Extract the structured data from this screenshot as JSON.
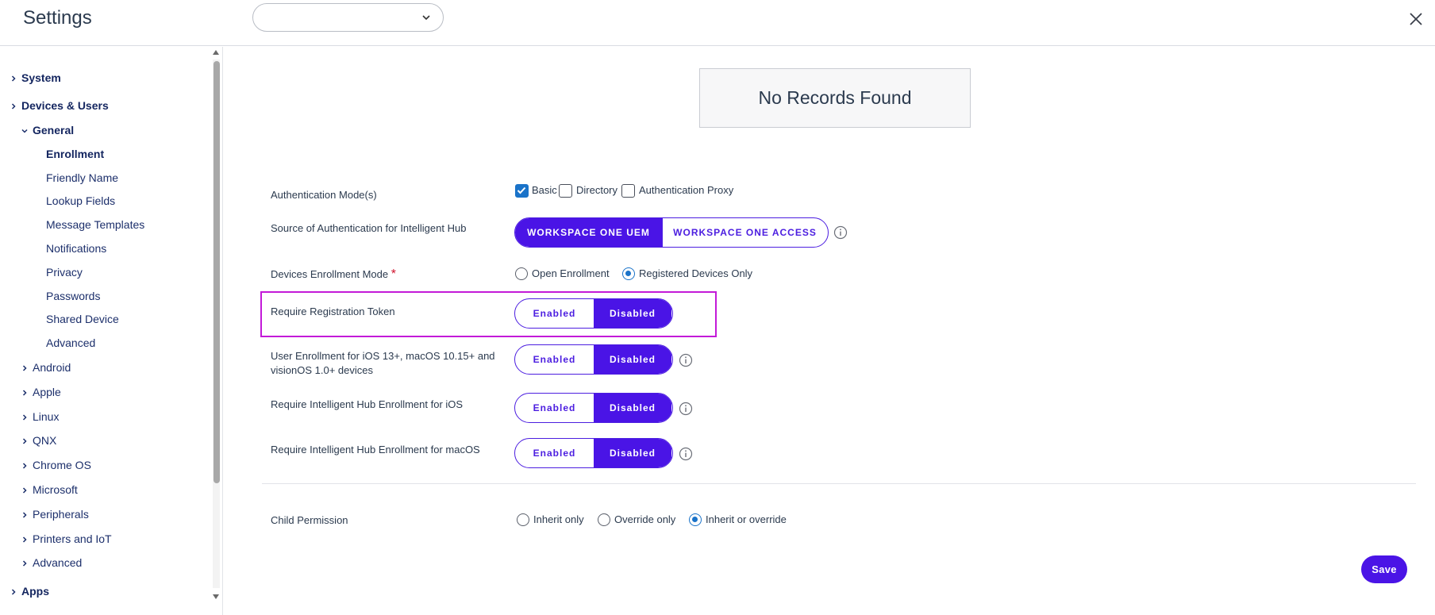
{
  "header": {
    "title": "Settings",
    "select_value": ""
  },
  "sidebar": {
    "items": [
      {
        "label": "System",
        "level": "top",
        "expanded": false
      },
      {
        "label": "Devices & Users",
        "level": "top",
        "expanded": true
      },
      {
        "label": "General",
        "level": "group",
        "expanded": true
      },
      {
        "label": "Enrollment",
        "level": "leaf",
        "selected": true
      },
      {
        "label": "Friendly Name",
        "level": "leaf"
      },
      {
        "label": "Lookup Fields",
        "level": "leaf"
      },
      {
        "label": "Message Templates",
        "level": "leaf"
      },
      {
        "label": "Notifications",
        "level": "leaf"
      },
      {
        "label": "Privacy",
        "level": "leaf"
      },
      {
        "label": "Passwords",
        "level": "leaf"
      },
      {
        "label": "Shared Device",
        "level": "leaf"
      },
      {
        "label": "Advanced",
        "level": "leaf"
      },
      {
        "label": "Android",
        "level": "group",
        "expanded": false
      },
      {
        "label": "Apple",
        "level": "group",
        "expanded": false
      },
      {
        "label": "Linux",
        "level": "group",
        "expanded": false
      },
      {
        "label": "QNX",
        "level": "group",
        "expanded": false
      },
      {
        "label": "Chrome OS",
        "level": "group",
        "expanded": false
      },
      {
        "label": "Microsoft",
        "level": "group",
        "expanded": false
      },
      {
        "label": "Peripherals",
        "level": "group",
        "expanded": false
      },
      {
        "label": "Printers and IoT",
        "level": "group",
        "expanded": false
      },
      {
        "label": "Advanced",
        "level": "group",
        "expanded": false
      },
      {
        "label": "Apps",
        "level": "top",
        "expanded": false
      }
    ]
  },
  "main": {
    "no_records": "No Records Found",
    "auth_modes": {
      "label": "Authentication Mode(s)",
      "options": [
        {
          "label": "Basic",
          "checked": true
        },
        {
          "label": "Directory",
          "checked": false
        },
        {
          "label": "Authentication Proxy",
          "checked": false
        }
      ]
    },
    "auth_source": {
      "label": "Source of Authentication for Intelligent Hub",
      "options": [
        "WORKSPACE ONE UEM",
        "WORKSPACE ONE ACCESS"
      ],
      "selected": 0
    },
    "enrollment_mode": {
      "label": "Devices Enrollment Mode",
      "required_mark": "*",
      "options": [
        {
          "label": "Open Enrollment",
          "checked": false
        },
        {
          "label": "Registered Devices Only",
          "checked": true
        }
      ]
    },
    "registration_token": {
      "label": "Require Registration Token",
      "enabled": "Enabled",
      "disabled": "Disabled",
      "selected": "disabled"
    },
    "user_enrollment": {
      "label_line1": "User Enrollment for iOS 13+, macOS 10.15+ and",
      "label_line2": "visionOS 1.0+ devices",
      "enabled": "Enabled",
      "disabled": "Disabled",
      "selected": "disabled"
    },
    "hub_ios": {
      "label": "Require Intelligent Hub Enrollment for iOS",
      "enabled": "Enabled",
      "disabled": "Disabled",
      "selected": "disabled"
    },
    "hub_macos": {
      "label": "Require Intelligent Hub Enrollment for macOS",
      "enabled": "Enabled",
      "disabled": "Disabled",
      "selected": "disabled"
    },
    "child_permission": {
      "label": "Child Permission",
      "options": [
        {
          "label": "Inherit only",
          "checked": false
        },
        {
          "label": "Override only",
          "checked": false
        },
        {
          "label": "Inherit or override",
          "checked": true
        }
      ]
    },
    "save_label": "Save"
  },
  "colors": {
    "accent": "#4a14e6",
    "radio_checked": "#1a73c9",
    "highlight": "#c31ad8",
    "nav_text": "#1c2f6b"
  }
}
